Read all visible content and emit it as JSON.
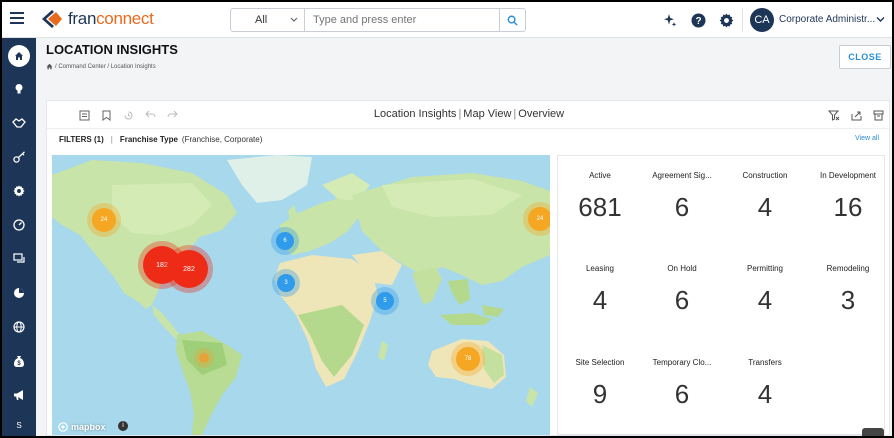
{
  "header": {
    "logo_text_a": "fran",
    "logo_text_b": "connect",
    "search_select": "All",
    "search_placeholder": "Type and press enter",
    "user_initials": "CA",
    "user_name": "Corporate Administr..."
  },
  "sidebar": {
    "items": [
      "home-icon",
      "bulb-icon",
      "handshake-icon",
      "key-icon",
      "gear-icon",
      "gauge-icon",
      "chat-icon",
      "pie-icon",
      "globe-icon",
      "money-bag-icon",
      "megaphone-icon",
      "s-icon"
    ],
    "bottom_label": "S"
  },
  "page": {
    "title": "LOCATION INSIGHTS",
    "breadcrumb": "/ Command Center / Location Insights",
    "close_label": "CLOSE"
  },
  "toolbar": {
    "title_a": "Location Insights",
    "title_b": "Map View",
    "title_c": "Overview"
  },
  "filters": {
    "label": "FILTERS (1)",
    "name": "Franchise Type",
    "value": "(Franchise, Corporate)",
    "view_all": "View all"
  },
  "map": {
    "attribution": "mapbox",
    "clusters": [
      {
        "label": "24",
        "color": "#f5a623"
      },
      {
        "label": "182",
        "color": "#ee2b16"
      },
      {
        "label": "282",
        "color": "#ee2b16"
      },
      {
        "label": "6",
        "color": "#2f9bea"
      },
      {
        "label": "3",
        "color": "#2f9bea"
      },
      {
        "label": "5",
        "color": "#2f9bea"
      },
      {
        "label": "78",
        "color": "#f5a623"
      },
      {
        "label": "24",
        "color": "#f5a623"
      },
      {
        "label": "",
        "color": "#e8a23a"
      }
    ]
  },
  "stats": [
    {
      "label": "Active",
      "value": "681"
    },
    {
      "label": "Agreement Sig...",
      "value": "6"
    },
    {
      "label": "Construction",
      "value": "4"
    },
    {
      "label": "In Development",
      "value": "16"
    },
    {
      "label": "Leasing",
      "value": "4"
    },
    {
      "label": "On Hold",
      "value": "6"
    },
    {
      "label": "Permitting",
      "value": "4"
    },
    {
      "label": "Remodeling",
      "value": "3"
    },
    {
      "label": "Site Selection",
      "value": "9"
    },
    {
      "label": "Temporary Clo...",
      "value": "6"
    },
    {
      "label": "Transfers",
      "value": "4"
    }
  ],
  "colors": {
    "navy": "#1d3557",
    "accent_blue": "#2b8fd6",
    "brand_orange": "#e86a1f"
  }
}
